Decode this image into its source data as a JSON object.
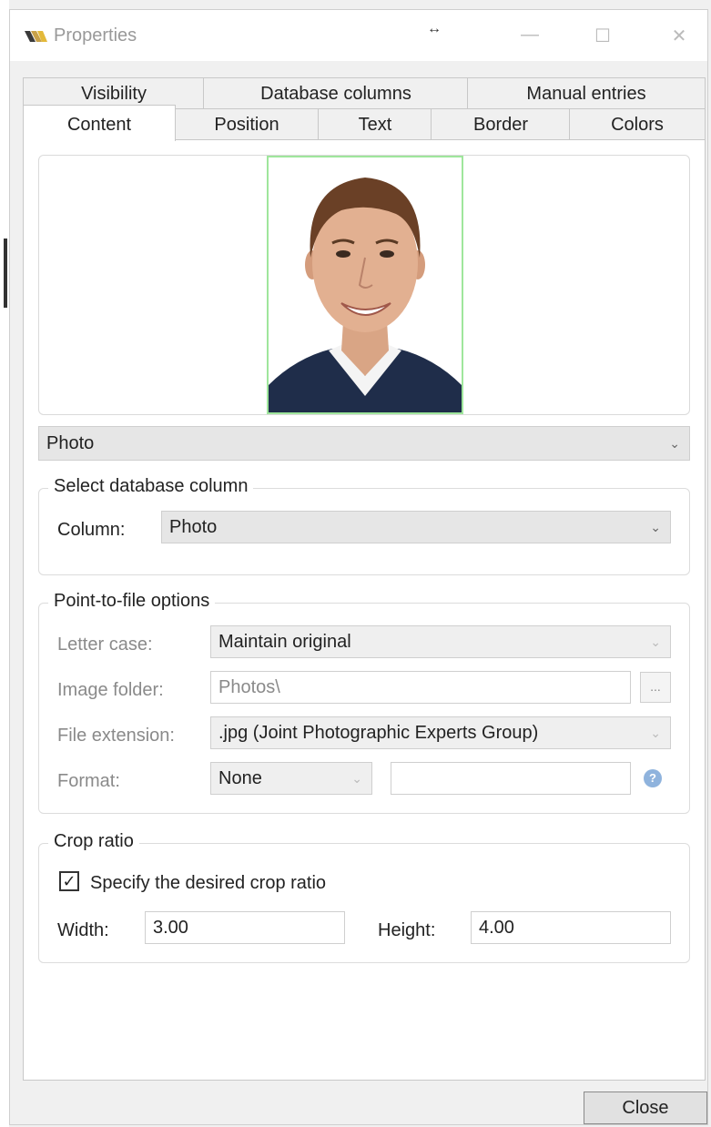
{
  "window": {
    "title": "Properties"
  },
  "tabs": {
    "row_back": [
      "Visibility",
      "Database columns",
      "Manual entries"
    ],
    "row_front": [
      "Content",
      "Position",
      "Text",
      "Border",
      "Colors"
    ],
    "active": "Content"
  },
  "content": {
    "field_select": {
      "value": "Photo"
    },
    "db_group": {
      "title": "Select database column",
      "column_label": "Column:",
      "column_value": "Photo"
    },
    "ptf_group": {
      "title": "Point-to-file options",
      "letter_case_label": "Letter case:",
      "letter_case_value": "Maintain original",
      "image_folder_label": "Image folder:",
      "image_folder_value": "Photos\\",
      "browse_label": "...",
      "file_ext_label": "File extension:",
      "file_ext_value": ".jpg (Joint Photographic Experts Group)",
      "format_label": "Format:",
      "format_value": "None",
      "format_text": "",
      "help_glyph": "?"
    },
    "crop_group": {
      "title": "Crop ratio",
      "checkbox_label": "Specify the desired crop ratio",
      "checked": true,
      "width_label": "Width:",
      "width_value": "3.00",
      "height_label": "Height:",
      "height_value": "4.00"
    }
  },
  "footer": {
    "close_label": "Close"
  },
  "icons": {
    "app": "app-logo-icon",
    "resize": "resize-icon",
    "minimize": "minimize-icon",
    "maximize": "maximize-icon",
    "close": "close-icon",
    "chevron": "chevron-down-icon",
    "help": "help-icon"
  },
  "colors": {
    "photo_border": "#9fe69c",
    "help": "#8fb3dd"
  }
}
